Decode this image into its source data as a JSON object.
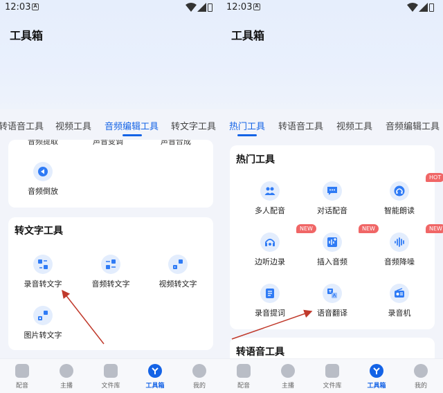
{
  "left_screen": {
    "status_time": "12:03",
    "title": "工具箱",
    "tabs": [
      "转语音工具",
      "视频工具",
      "音频编辑工具",
      "转文字工具"
    ],
    "active_tab": "音频编辑工具",
    "cut_tools": [
      "音频提取",
      "声音变调",
      "声音合成"
    ],
    "audio_edit_tools": [
      {
        "label": "音频倒放",
        "icon": "rewind-icon"
      }
    ],
    "text_section": {
      "title": "转文字工具",
      "tools": [
        {
          "label": "录音转文字",
          "icon": "speech-to-text-icon"
        },
        {
          "label": "音频转文字",
          "icon": "audio-to-text-icon"
        },
        {
          "label": "视频转文字",
          "icon": "video-to-text-icon"
        },
        {
          "label": "图片转文字",
          "icon": "image-to-text-icon"
        }
      ]
    }
  },
  "right_screen": {
    "status_time": "12:03",
    "title": "工具箱",
    "tabs": [
      "热门工具",
      "转语音工具",
      "视频工具",
      "音频编辑工具"
    ],
    "active_tab": "热门工具",
    "hot_section": {
      "title": "热门工具",
      "tools": [
        {
          "label": "多人配音",
          "icon": "group-dub-icon",
          "badge": ""
        },
        {
          "label": "对话配音",
          "icon": "chat-dub-icon",
          "badge": ""
        },
        {
          "label": "智能朗读",
          "icon": "headphones-icon",
          "badge": "HOT"
        },
        {
          "label": "边听边录",
          "icon": "listen-record-icon",
          "badge": "NEW"
        },
        {
          "label": "插入音频",
          "icon": "insert-audio-icon",
          "badge": "NEW"
        },
        {
          "label": "音频降噪",
          "icon": "denoise-icon",
          "badge": "NEW"
        },
        {
          "label": "录音提词",
          "icon": "teleprompter-icon",
          "badge": ""
        },
        {
          "label": "语音翻译",
          "icon": "translate-icon",
          "badge": ""
        },
        {
          "label": "录音机",
          "icon": "recorder-icon",
          "badge": ""
        }
      ]
    },
    "next_section_title": "转语音工具"
  },
  "bottom_nav": [
    "配音",
    "主播",
    "文件库",
    "工具箱",
    "我的"
  ],
  "bottom_nav_active": "工具箱",
  "colors": {
    "accent": "#1463e6",
    "badge": "#f06666",
    "icon_bg": "#e3edfd",
    "arrow": "#c0392b"
  }
}
